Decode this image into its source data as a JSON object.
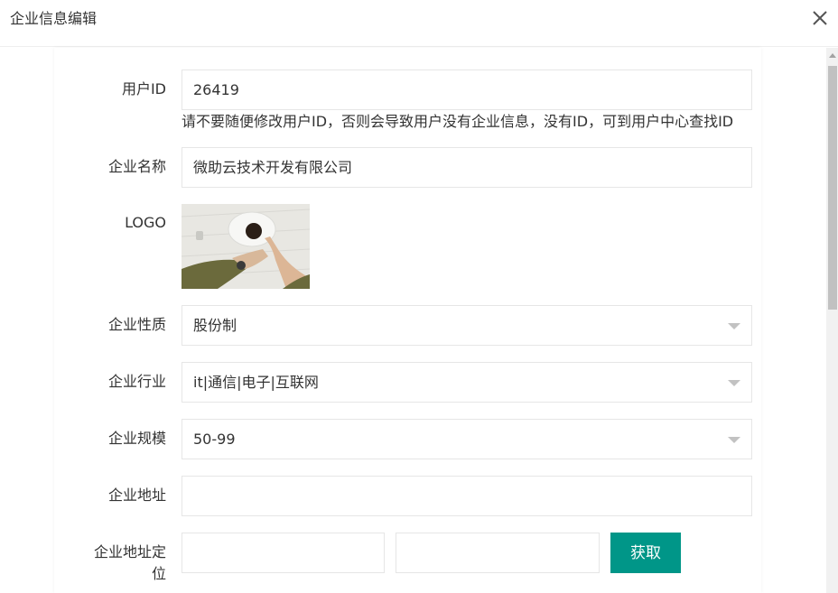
{
  "dialog": {
    "title": "企业信息编辑",
    "close_icon": "close-icon"
  },
  "form": {
    "user_id": {
      "label": "用户ID",
      "value": "26419",
      "hint": "请不要随便修改用户ID，否则会导致用户没有企业信息，没有ID，可到用户中心查找ID"
    },
    "company_name": {
      "label": "企业名称",
      "value": "微助云技术开发有限公司"
    },
    "logo": {
      "label": "LOGO"
    },
    "nature": {
      "label": "企业性质",
      "value": "股份制"
    },
    "industry": {
      "label": "企业行业",
      "value": "it|通信|电子|互联网"
    },
    "scale": {
      "label": "企业规模",
      "value": "50-99"
    },
    "address": {
      "label": "企业地址",
      "value": ""
    },
    "location": {
      "label_line1": "企业地址定",
      "label_line2": "位",
      "lng_value": "",
      "lat_value": "",
      "get_button": "获取"
    }
  },
  "colors": {
    "primary": "#009688",
    "border": "#e6e6e6",
    "arrow": "#c2c2c2"
  }
}
